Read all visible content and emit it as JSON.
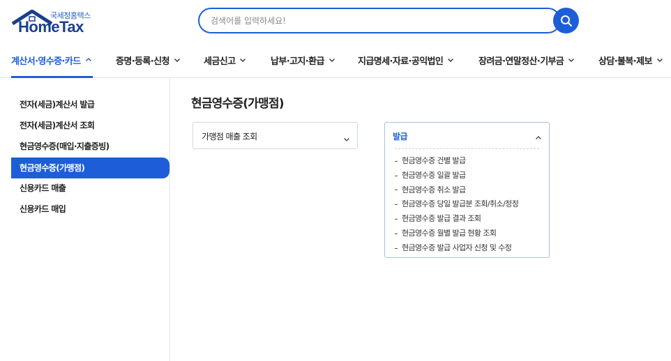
{
  "logo": {
    "sub": "국세청홈택스",
    "main": "HomeTax"
  },
  "search": {
    "placeholder": "검색어를 입력하세요!"
  },
  "nav": {
    "items": [
      {
        "label": "계산서·영수증·카드"
      },
      {
        "label": "증명·등록·신청"
      },
      {
        "label": "세금신고"
      },
      {
        "label": "납부·고지·환급"
      },
      {
        "label": "지급명세·자료·공익법인"
      },
      {
        "label": "장려금·연말정산·기부금"
      },
      {
        "label": "상담·불복·제보"
      }
    ]
  },
  "sidebar": {
    "items": [
      {
        "label": "전자(세금)계산서 발급"
      },
      {
        "label": "전자(세금)계산서 조회"
      },
      {
        "label": "현금영수증(매입·지출증빙)"
      },
      {
        "label": "현금영수증(가맹점)"
      },
      {
        "label": "신용카드 매출"
      },
      {
        "label": "신용카드 매입"
      }
    ]
  },
  "main": {
    "title": "현금영수증(가맹점)",
    "accordion_closed": {
      "label": "가맹점 매출 조회"
    },
    "accordion_open": {
      "label": "발급",
      "items": [
        "현금영수증 건별 발급",
        "현금영수증 일괄 발급",
        "현금영수증 취소 발급",
        "현금영수증 당일 발급분 조회/취소/정정",
        "현금영수증 발급 결과 조회",
        "현금영수증 월별 발급 현황 조회",
        "현금영수증 발급 사업자 신청 및 수정"
      ]
    }
  },
  "colors": {
    "accent": "#1d5ed8",
    "logo": "#1b3f8f"
  },
  "icons": {
    "search": "search-icon",
    "chevron": "chevron-down-icon"
  }
}
